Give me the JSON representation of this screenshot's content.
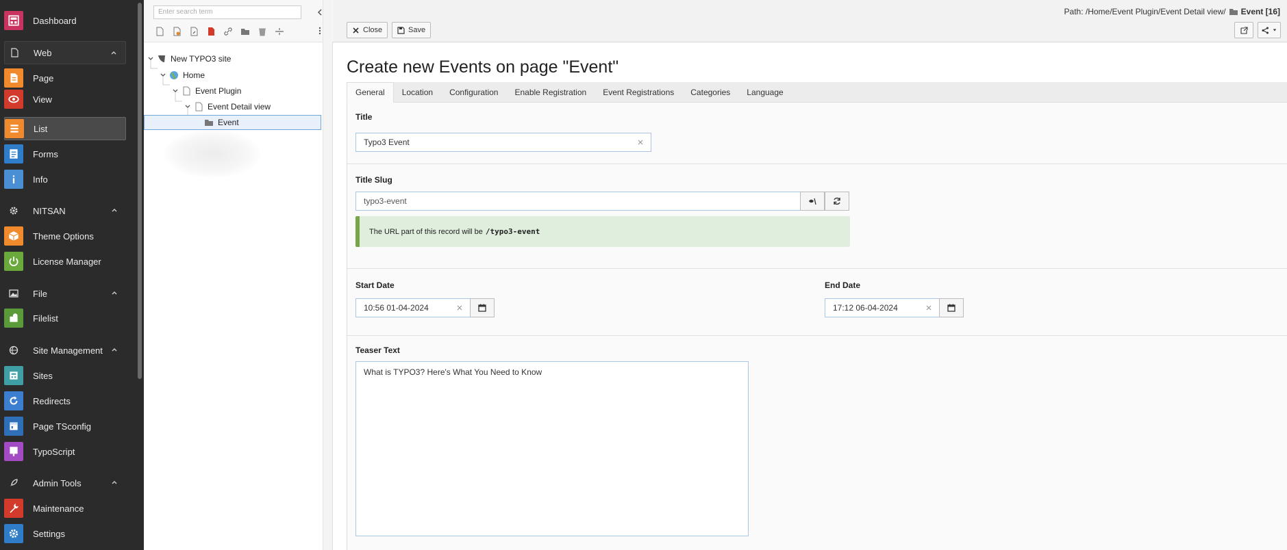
{
  "modules": {
    "dashboard": "Dashboard",
    "web": {
      "label": "Web",
      "items": [
        "Page",
        "View",
        "List",
        "Forms",
        "Info"
      ]
    },
    "nitsan": {
      "label": "NITSAN",
      "items": [
        "Theme Options",
        "License Manager"
      ]
    },
    "file": {
      "label": "File",
      "items": [
        "Filelist"
      ]
    },
    "site_management": {
      "label": "Site Management",
      "items": [
        "Sites",
        "Redirects",
        "Page TSconfig",
        "TypoScript"
      ]
    },
    "admin_tools": {
      "label": "Admin Tools",
      "items": [
        "Maintenance",
        "Settings"
      ]
    }
  },
  "tree": {
    "search_placeholder": "Enter search term",
    "nodes": [
      "New TYPO3 site",
      "Home",
      "Event Plugin",
      "Event Detail view",
      "Event"
    ]
  },
  "header": {
    "path_label": "Path: /Home/Event Plugin/Event Detail view/",
    "path_current": "Event [16]",
    "close_label": "Close",
    "save_label": "Save"
  },
  "page_title": "Create new Events on page \"Event\"",
  "tabs": [
    "General",
    "Location",
    "Configuration",
    "Enable Registration",
    "Event Registrations",
    "Categories",
    "Language"
  ],
  "form": {
    "title_label": "Title",
    "title_value": "Typo3 Event",
    "slug_label": "Title Slug",
    "slug_value": "typo3-event",
    "slug_notice": "The URL part of this record will be",
    "slug_notice_code": "/typo3-event",
    "start_label": "Start Date",
    "start_value": "10:56 01-04-2024",
    "end_label": "End Date",
    "end_value": "17:12 06-04-2024",
    "teaser_label": "Teaser Text",
    "teaser_value": "What is TYPO3? Here's What You Need to Know"
  },
  "colors": {
    "sidebar_bg": "#2b2b2b",
    "accent_blue": "#6fa8dc",
    "notice_green": "#79a548"
  }
}
